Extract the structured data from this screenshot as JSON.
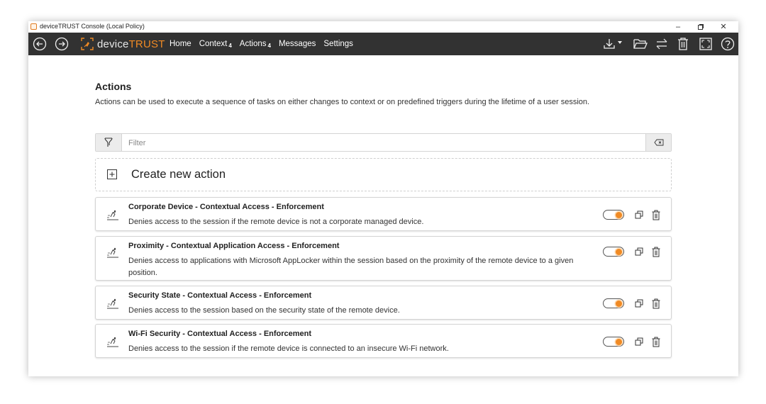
{
  "window": {
    "title": "deviceTRUST Console (Local Policy)"
  },
  "controls": {
    "minimize": "–",
    "maximize": "๑",
    "close": "✕"
  },
  "logo": {
    "prefix": "device",
    "brand": "TRUST"
  },
  "nav": [
    {
      "label": "Home",
      "badge": ""
    },
    {
      "label": "Context",
      "badge": "4"
    },
    {
      "label": "Actions",
      "badge": "4"
    },
    {
      "label": "Messages",
      "badge": ""
    },
    {
      "label": "Settings",
      "badge": ""
    }
  ],
  "page": {
    "title": "Actions",
    "description": "Actions can be used to execute a sequence of tasks on either changes to context or on predefined triggers during the lifetime of a user session."
  },
  "filter": {
    "placeholder": "Filter",
    "value": ""
  },
  "create": {
    "label": "Create new action"
  },
  "actions": [
    {
      "title": "Corporate Device - Contextual Access - Enforcement",
      "description": "Denies access to the session if the remote device is not a corporate managed device.",
      "enabled": true
    },
    {
      "title": "Proximity - Contextual Application Access - Enforcement",
      "description": "Denies access to applications with Microsoft AppLocker within the session based on the proximity of the remote device to a given position.",
      "enabled": true
    },
    {
      "title": "Security State - Contextual Access - Enforcement",
      "description": "Denies access to the session based on the security state of the remote device.",
      "enabled": true
    },
    {
      "title": "Wi-Fi Security - Contextual Access - Enforcement",
      "description": "Denies access to the session if the remote device is connected to an insecure Wi-Fi network.",
      "enabled": true
    }
  ],
  "colors": {
    "toolbar": "#323232",
    "accent": "#f08a24",
    "text": "#222222"
  },
  "icons": {
    "toolbar": [
      "back-icon",
      "forward-icon",
      "download-icon",
      "folder-open-icon",
      "sync-icon",
      "trash-icon",
      "fullscreen-icon",
      "help-icon"
    ],
    "filter": "filter-icon",
    "clear": "clear-icon",
    "create": "plus-icon",
    "card": "action-run-icon",
    "duplicate": "duplicate-icon",
    "delete": "trash-icon"
  }
}
